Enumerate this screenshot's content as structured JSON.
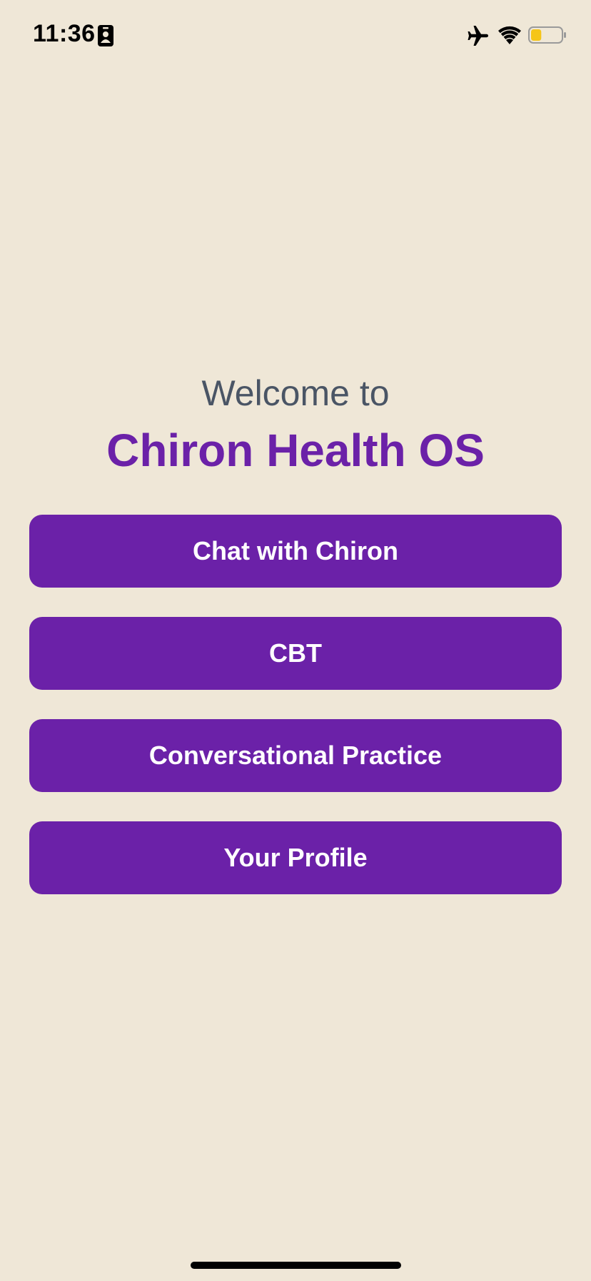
{
  "status_bar": {
    "time": "11:36",
    "icons": [
      "id-card-icon",
      "airplane-mode-icon",
      "wifi-icon",
      "battery-icon"
    ],
    "battery_level_percent": 35,
    "battery_color": "#F5C518"
  },
  "welcome": {
    "greeting": "Welcome to",
    "app_name": "Chiron Health OS"
  },
  "menu": {
    "buttons": [
      {
        "label": "Chat with Chiron"
      },
      {
        "label": "CBT"
      },
      {
        "label": "Conversational Practice"
      },
      {
        "label": "Your Profile"
      }
    ]
  },
  "colors": {
    "background": "#EFE7D7",
    "accent": "#6B21A8",
    "greeting_text": "#4A5565",
    "button_text": "#FFFFFF"
  }
}
